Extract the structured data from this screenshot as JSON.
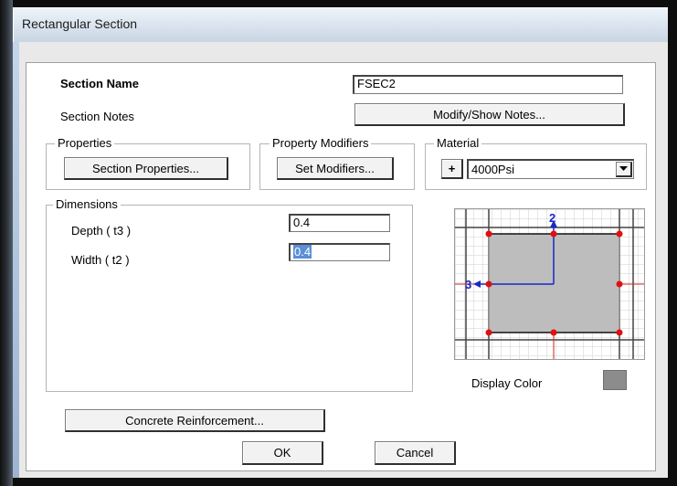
{
  "window": {
    "title": "Rectangular Section"
  },
  "section": {
    "name_label": "Section Name",
    "name_value": "FSEC2",
    "notes_label": "Section Notes",
    "notes_button": "Modify/Show Notes..."
  },
  "properties": {
    "legend": "Properties",
    "button": "Section Properties..."
  },
  "modifiers": {
    "legend": "Property Modifiers",
    "button": "Set Modifiers..."
  },
  "material": {
    "legend": "Material",
    "plus_button": "+",
    "selected": "4000Psi",
    "dropdown_icon": "chevron-down-icon"
  },
  "dimensions": {
    "legend": "Dimensions",
    "depth_label": "Depth  ( t3 )",
    "depth_value": "0.4",
    "width_label": "Width  ( t2 )",
    "width_value": "0.4"
  },
  "preview": {
    "axis_2": "2",
    "axis_3": "3",
    "display_color_label": "Display Color",
    "display_color": "#8c8c8c"
  },
  "buttons": {
    "reinforcement": "Concrete Reinforcement...",
    "ok": "OK",
    "cancel": "Cancel"
  }
}
